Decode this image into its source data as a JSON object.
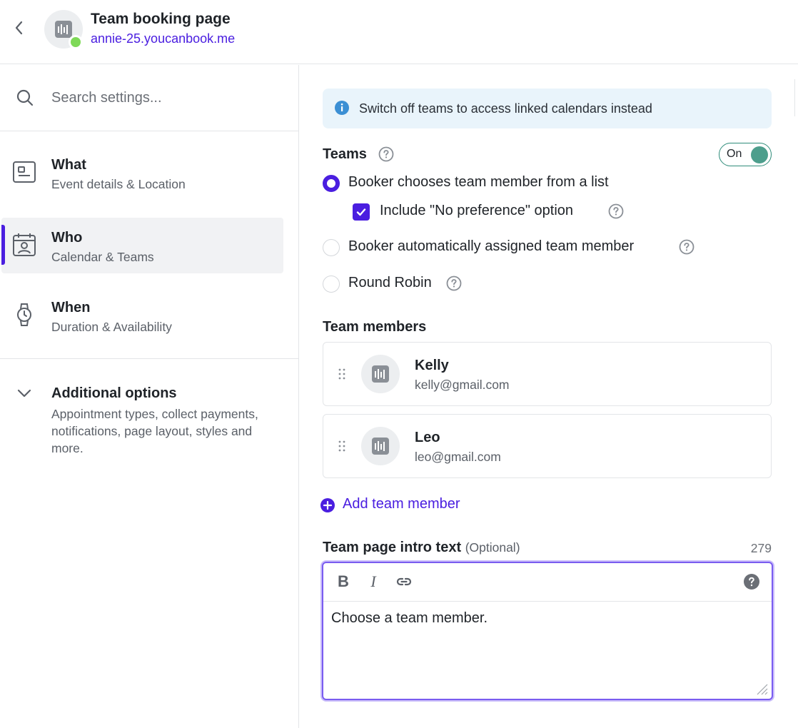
{
  "header": {
    "title": "Team booking page",
    "url": "annie-25.youcanbook.me",
    "status_color": "#7ed957"
  },
  "sidebar": {
    "search_placeholder": "Search settings...",
    "items": [
      {
        "label": "What",
        "sub": "Event details & Location",
        "icon": "document-icon",
        "active": false
      },
      {
        "label": "Who",
        "sub": "Calendar & Teams",
        "icon": "calendar-person-icon",
        "active": true
      },
      {
        "label": "When",
        "sub": "Duration & Availability",
        "icon": "watch-icon",
        "active": false
      }
    ],
    "additional": {
      "label": "Additional options",
      "sub": "Appointment types, collect payments, notifications, page layout, styles and more."
    }
  },
  "main": {
    "info_banner": "Switch off teams to access linked calendars instead",
    "teams_heading": "Teams",
    "toggle_label": "On",
    "toggle_on": true,
    "options": {
      "list": "Booker chooses team member from a list",
      "no_preference": "Include \"No preference\" option",
      "auto": "Booker automatically assigned team member",
      "round_robin": "Round Robin"
    },
    "selected_option": "list",
    "no_preference_checked": true,
    "members_heading": "Team members",
    "members": [
      {
        "name": "Kelly",
        "email": "kelly@gmail.com"
      },
      {
        "name": "Leo",
        "email": "leo@gmail.com"
      }
    ],
    "add_member": "Add team member",
    "intro_label": "Team page intro text",
    "intro_optional": "(Optional)",
    "intro_count": "279",
    "intro_text": "Choose a team member."
  },
  "colors": {
    "accent": "#4a1ee0",
    "toggle": "#4d9e8c",
    "info_bg": "#e9f4fb"
  }
}
